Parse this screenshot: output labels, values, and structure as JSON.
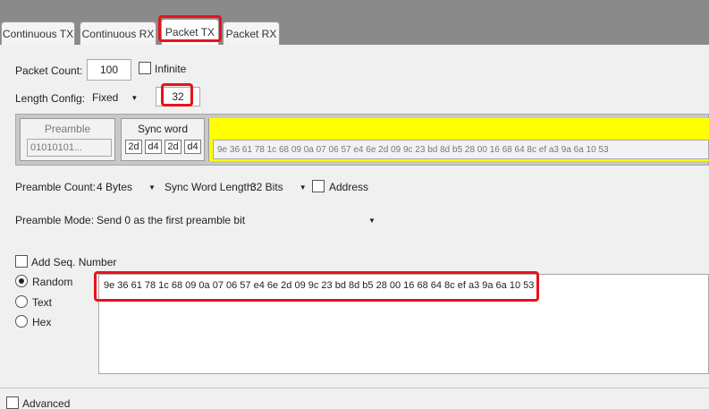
{
  "tabs": [
    {
      "label": "Continuous TX"
    },
    {
      "label": "Continuous RX"
    },
    {
      "label": "Packet TX"
    },
    {
      "label": "Packet RX"
    }
  ],
  "packet_count": {
    "label": "Packet Count:",
    "value": "100",
    "infinite_label": "Infinite"
  },
  "length_config": {
    "label": "Length Config:",
    "mode": "Fixed",
    "value": "32"
  },
  "frame": {
    "preamble_title": "Preamble",
    "preamble_value": "01010101...",
    "sync_title": "Sync word",
    "sync_bytes": [
      "2d",
      "d4",
      "2d",
      "d4"
    ],
    "payload": "9e 36 61 78 1c 68 09 0a 07 06 57 e4 6e 2d 09 9c 23 bd 8d b5 28 00 16 68 64 8c ef a3 9a 6a 10 53"
  },
  "preamble_count": {
    "label": "Preamble Count:",
    "value": "4 Bytes"
  },
  "sync_word_length": {
    "label": "Sync Word Length:",
    "value": "32 Bits"
  },
  "address": {
    "label": "Address"
  },
  "preamble_mode": {
    "label": "Preamble Mode:",
    "value": "Send 0 as the first preamble bit"
  },
  "add_seq": {
    "label": "Add Seq. Number"
  },
  "data_type": {
    "random": "Random",
    "text": "Text",
    "hex": "Hex"
  },
  "data_content": "9e 36 61 78 1c 68 09 0a 07 06 57 e4 6e 2d 09 9c 23 bd 8d b5 28 00 16 68 64 8c ef a3 9a 6a 10 53",
  "advanced": {
    "label": "Advanced"
  },
  "colors": {
    "highlight": "#e8121a",
    "payload_bg": "#ffff00"
  }
}
